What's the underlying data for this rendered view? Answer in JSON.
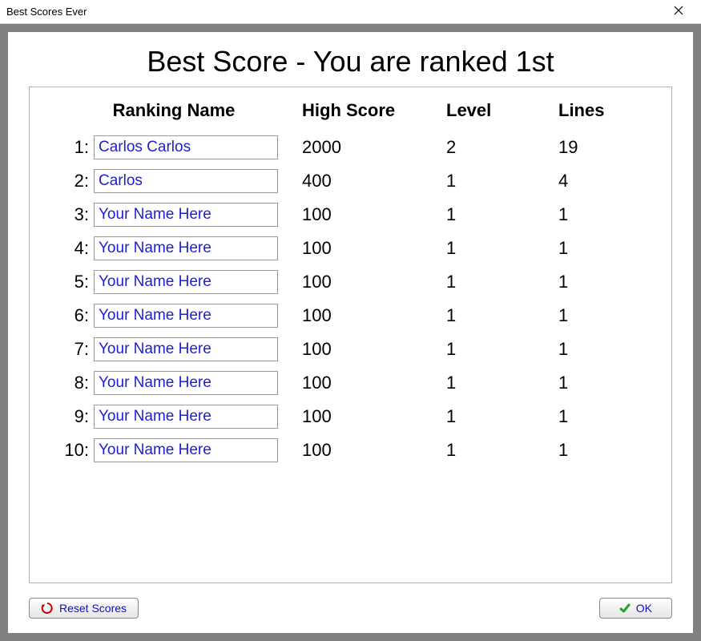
{
  "window": {
    "title": "Best Scores Ever",
    "close_icon": "close-icon"
  },
  "heading": "Best Score - You are ranked 1st",
  "headers": {
    "rank_name": "Ranking Name",
    "high_score": "High Score",
    "level": "Level",
    "lines": "Lines"
  },
  "rows": [
    {
      "rank": "1:",
      "name": "Carlos Carlos",
      "placeholder": "",
      "score": "2000",
      "level": "2",
      "lines": "19"
    },
    {
      "rank": "2:",
      "name": "Carlos",
      "placeholder": "",
      "score": "400",
      "level": "1",
      "lines": "4"
    },
    {
      "rank": "3:",
      "name": "",
      "placeholder": "Your Name Here",
      "score": "100",
      "level": "1",
      "lines": "1"
    },
    {
      "rank": "4:",
      "name": "",
      "placeholder": "Your Name Here",
      "score": "100",
      "level": "1",
      "lines": "1"
    },
    {
      "rank": "5:",
      "name": "",
      "placeholder": "Your Name Here",
      "score": "100",
      "level": "1",
      "lines": "1"
    },
    {
      "rank": "6:",
      "name": "",
      "placeholder": "Your Name Here",
      "score": "100",
      "level": "1",
      "lines": "1"
    },
    {
      "rank": "7:",
      "name": "",
      "placeholder": "Your Name Here",
      "score": "100",
      "level": "1",
      "lines": "1"
    },
    {
      "rank": "8:",
      "name": "",
      "placeholder": "Your Name Here",
      "score": "100",
      "level": "1",
      "lines": "1"
    },
    {
      "rank": "9:",
      "name": "",
      "placeholder": "Your Name Here",
      "score": "100",
      "level": "1",
      "lines": "1"
    },
    {
      "rank": "10:",
      "name": "",
      "placeholder": "Your Name Here",
      "score": "100",
      "level": "1",
      "lines": "1"
    }
  ],
  "buttons": {
    "reset": "Reset Scores",
    "ok": "OK"
  }
}
